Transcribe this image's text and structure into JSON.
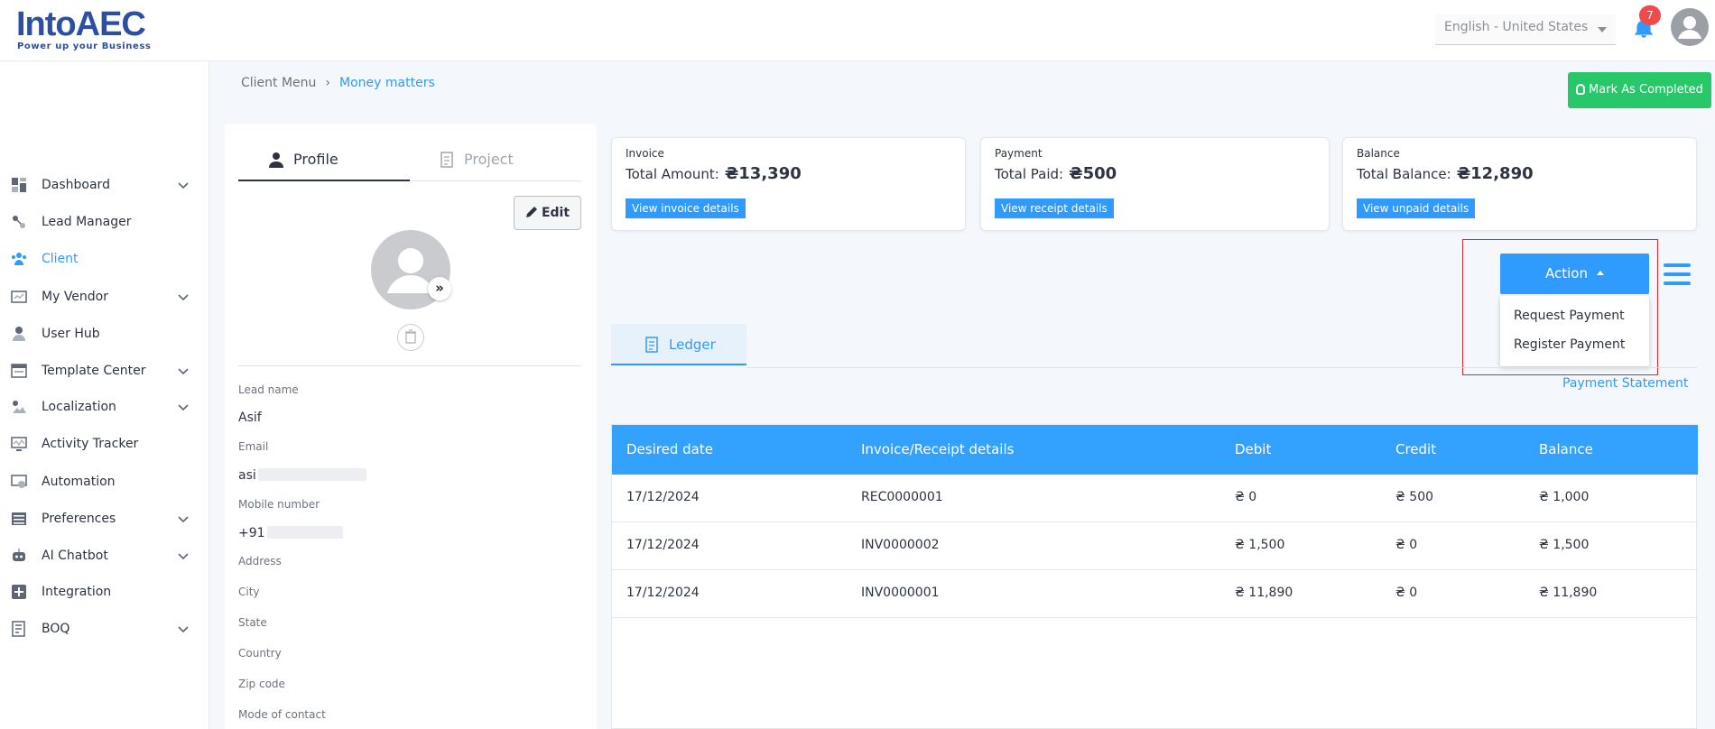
{
  "header": {
    "logo_text": "IntoAEC",
    "logo_tagline": "Power up your Business",
    "language": "English - United States",
    "notification_count": "7"
  },
  "sidebar": {
    "items": [
      {
        "label": "Dashboard",
        "icon": "dashboard-icon",
        "has_chevron": true
      },
      {
        "label": "Lead Manager",
        "icon": "lead-manager-icon",
        "has_chevron": false
      },
      {
        "label": "Client",
        "icon": "client-icon",
        "has_chevron": false,
        "active": true
      },
      {
        "label": "My Vendor",
        "icon": "vendor-icon",
        "has_chevron": true
      },
      {
        "label": "User Hub",
        "icon": "user-icon",
        "has_chevron": false
      },
      {
        "label": "Template Center",
        "icon": "template-icon",
        "has_chevron": true
      },
      {
        "label": "Localization",
        "icon": "localization-icon",
        "has_chevron": true
      },
      {
        "label": "Activity Tracker",
        "icon": "activity-icon",
        "has_chevron": false
      },
      {
        "label": "Automation",
        "icon": "automation-icon",
        "has_chevron": false
      },
      {
        "label": "Preferences",
        "icon": "preferences-icon",
        "has_chevron": true
      },
      {
        "label": "AI Chatbot",
        "icon": "chatbot-icon",
        "has_chevron": true
      },
      {
        "label": "Integration",
        "icon": "integration-icon",
        "has_chevron": false
      },
      {
        "label": "BOQ",
        "icon": "boq-icon",
        "has_chevron": true
      }
    ]
  },
  "breadcrumb": {
    "parent": "Client Menu",
    "current": "Money matters"
  },
  "mark_completed_label": "Mark As Completed",
  "profile": {
    "tabs": [
      "Profile",
      "Project"
    ],
    "edit_label": "Edit",
    "fields": [
      {
        "label": "Lead name",
        "value": "Asif"
      },
      {
        "label": "Email",
        "value": "asi"
      },
      {
        "label": "Mobile number",
        "value": "+91"
      },
      {
        "label": "Address",
        "value": ""
      },
      {
        "label": "City",
        "value": ""
      },
      {
        "label": "State",
        "value": ""
      },
      {
        "label": "Country",
        "value": ""
      },
      {
        "label": "Zip code",
        "value": ""
      },
      {
        "label": "Mode of contact",
        "value": ""
      }
    ]
  },
  "summary": {
    "invoice": {
      "caption": "Invoice",
      "label": "Total Amount:",
      "amount": "₴13,390",
      "button": "View invoice details"
    },
    "payment": {
      "caption": "Payment",
      "label": "Total Paid:",
      "amount": "₴500",
      "button": "View receipt details"
    },
    "balance": {
      "caption": "Balance",
      "label": "Total Balance:",
      "amount": "₴12,890",
      "button": "View unpaid details"
    }
  },
  "action": {
    "label": "Action",
    "menu": [
      "Request Payment",
      "Register Payment"
    ]
  },
  "ledger_tab": "Ledger",
  "payment_statement": "Payment Statement",
  "table": {
    "headers": [
      "Desired date",
      "Invoice/Receipt details",
      "Debit",
      "Credit",
      "Balance"
    ],
    "rows": [
      [
        "17/12/2024",
        "REC0000001",
        "₴ 0",
        "₴ 500",
        "₴ 1,000"
      ],
      [
        "17/12/2024",
        "INV0000002",
        "₴ 1,500",
        "₴ 0",
        "₴ 1,500"
      ],
      [
        "17/12/2024",
        "INV0000001",
        "₴ 11,890",
        "₴ 0",
        "₴ 11,890"
      ]
    ]
  },
  "colors": {
    "accent": "#2f9bff",
    "success": "#27c76a",
    "highlight": "#e0262b",
    "brand": "#2b4fa3"
  }
}
